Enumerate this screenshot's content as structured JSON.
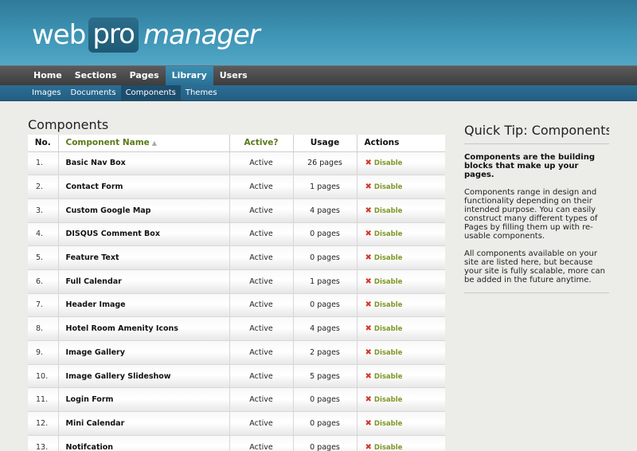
{
  "logo": {
    "part1": "web",
    "part2": "pro",
    "part3": "manager"
  },
  "main_nav": [
    {
      "label": "Home",
      "active": false
    },
    {
      "label": "Sections",
      "active": false
    },
    {
      "label": "Pages",
      "active": false
    },
    {
      "label": "Library",
      "active": true
    },
    {
      "label": "Users",
      "active": false
    }
  ],
  "sub_nav": [
    {
      "label": "Images",
      "active": false
    },
    {
      "label": "Documents",
      "active": false
    },
    {
      "label": "Components",
      "active": true
    },
    {
      "label": "Themes",
      "active": false
    }
  ],
  "page_title": "Components",
  "table": {
    "headers": {
      "no": "No.",
      "name": "Component Name",
      "active": "Active?",
      "usage": "Usage",
      "actions": "Actions"
    },
    "action_label": "Disable",
    "rows": [
      {
        "no": "1.",
        "name": "Basic Nav Box",
        "active": "Active",
        "usage": "26 pages"
      },
      {
        "no": "2.",
        "name": "Contact Form",
        "active": "Active",
        "usage": "1 pages"
      },
      {
        "no": "3.",
        "name": "Custom Google Map",
        "active": "Active",
        "usage": "4 pages"
      },
      {
        "no": "4.",
        "name": "DISQUS Comment Box",
        "active": "Active",
        "usage": "0 pages"
      },
      {
        "no": "5.",
        "name": "Feature Text",
        "active": "Active",
        "usage": "0 pages"
      },
      {
        "no": "6.",
        "name": "Full Calendar",
        "active": "Active",
        "usage": "1 pages"
      },
      {
        "no": "7.",
        "name": "Header Image",
        "active": "Active",
        "usage": "0 pages"
      },
      {
        "no": "8.",
        "name": "Hotel Room Amenity Icons",
        "active": "Active",
        "usage": "4 pages"
      },
      {
        "no": "9.",
        "name": "Image Gallery",
        "active": "Active",
        "usage": "2 pages"
      },
      {
        "no": "10.",
        "name": "Image Gallery Slideshow",
        "active": "Active",
        "usage": "5 pages"
      },
      {
        "no": "11.",
        "name": "Login Form",
        "active": "Active",
        "usage": "0 pages"
      },
      {
        "no": "12.",
        "name": "Mini Calendar",
        "active": "Active",
        "usage": "0 pages"
      },
      {
        "no": "13.",
        "name": "Notifcation",
        "active": "Active",
        "usage": "0 pages"
      }
    ]
  },
  "tip": {
    "title": "Quick Tip: Components",
    "lead": "Components are the building blocks that make up your pages.",
    "paragraphs": [
      "Components range in design and functionality depending on their intended purpose. You can easily construct many different types of Pages by filling them up with re-usable components.",
      "All components available on your site are listed here, but because your site is fully scalable, more can be added in the future anytime."
    ]
  },
  "icons": {
    "sort": "sort-up-arrow-icon",
    "disable": "red-x-icon"
  },
  "colors": {
    "header": "#3f95b6",
    "nav": "#4a4a4a",
    "subnav": "#2b6e96",
    "accent_green": "#7e9626",
    "disable_x": "#d23a2a"
  }
}
